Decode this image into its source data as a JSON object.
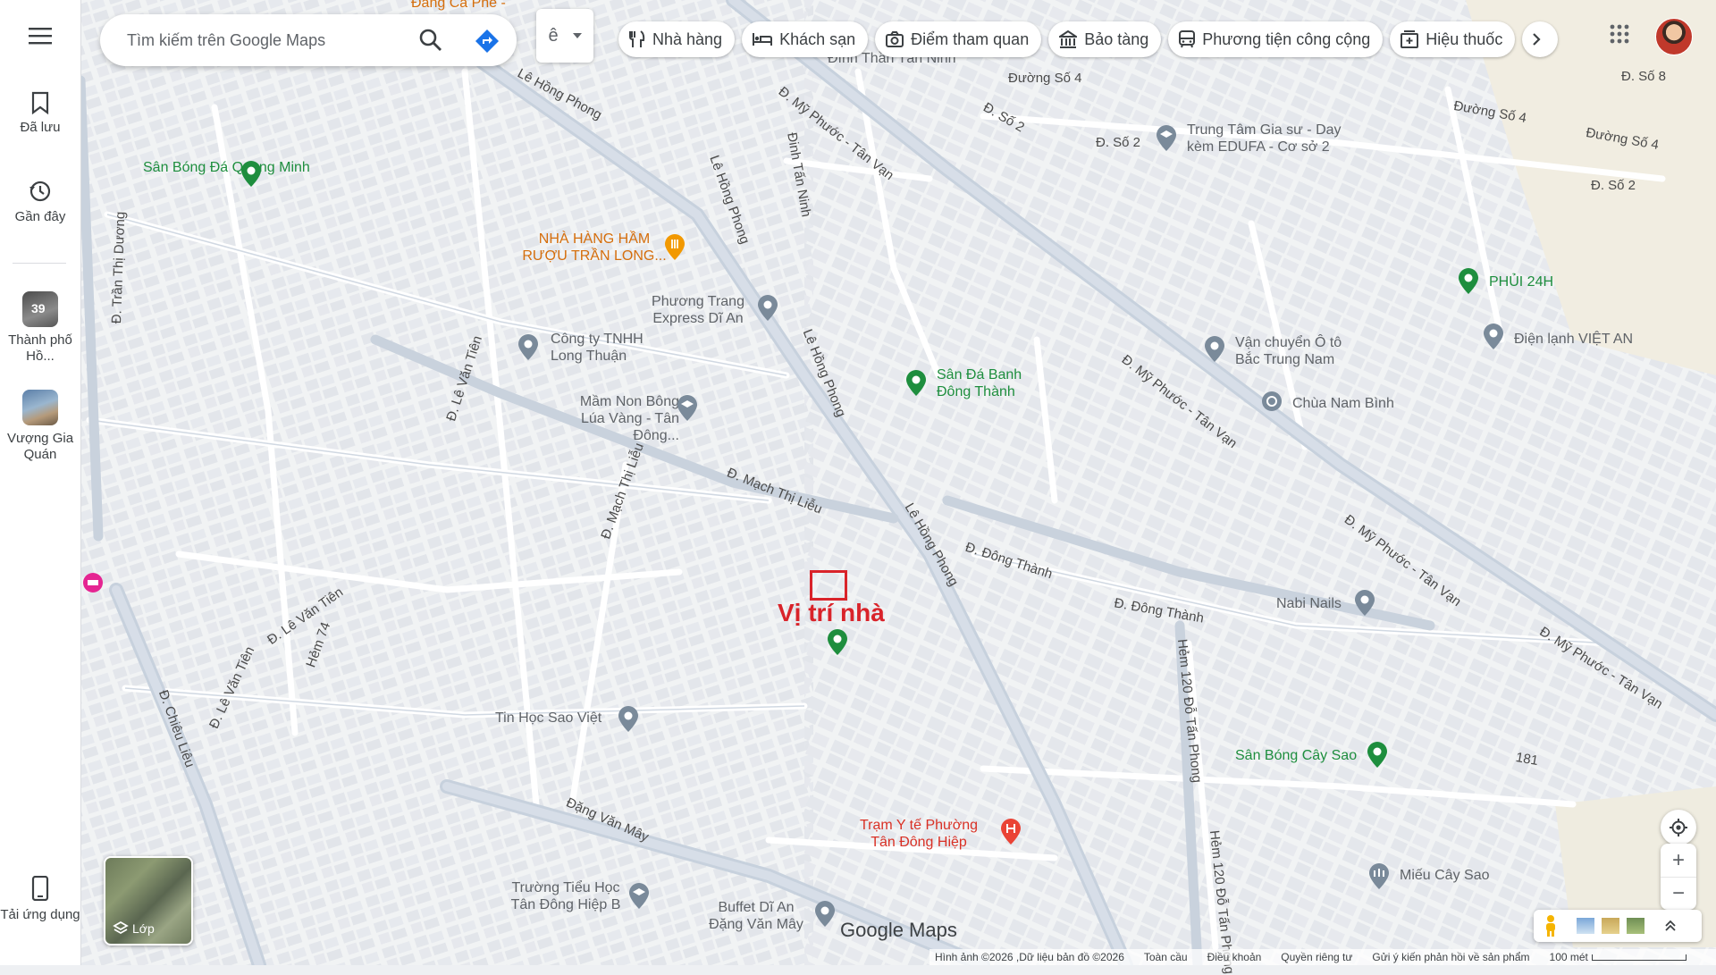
{
  "sidebar": {
    "menu_icon": "hamburger-menu-icon",
    "saved_label": "Đã lưu",
    "recent_label": "Gần đây",
    "recent_places": [
      {
        "label": "Thành phố Hồ...",
        "badge": "39"
      },
      {
        "label": "Vượng Gia Quán"
      }
    ],
    "get_app_label": "Tải ứng dụng"
  },
  "search": {
    "placeholder": "Tìm kiếm trên Google Maps",
    "search_icon": "search-icon",
    "directions_icon": "directions-icon"
  },
  "language": {
    "value": "ê"
  },
  "chips": [
    {
      "label": "Nhà hàng",
      "icon": "restaurant-icon"
    },
    {
      "label": "Khách sạn",
      "icon": "hotel-icon"
    },
    {
      "label": "Điểm tham quan",
      "icon": "camera-icon"
    },
    {
      "label": "Bảo tàng",
      "icon": "museum-icon"
    },
    {
      "label": "Phương tiện công cộng",
      "icon": "transit-icon"
    },
    {
      "label": "Hiệu thuốc",
      "icon": "pharmacy-icon"
    }
  ],
  "map": {
    "house_marker_label": "Vị trí nhà",
    "places": [
      {
        "name": "Sân Bóng Đá Quang Minh",
        "type": "green"
      },
      {
        "name": "NHÀ HÀNG HẦM RƯỢU TRẦN LONG...",
        "type": "orange"
      },
      {
        "name": "Phương Trang Express Dĩ An",
        "type": "poi"
      },
      {
        "name": "Công ty TNHH Long Thuận",
        "type": "poi"
      },
      {
        "name": "Mầm Non Bông Lúa Vàng - Tân Đông...",
        "type": "poi"
      },
      {
        "name": "Sân Đá Banh Đông Thành",
        "type": "green"
      },
      {
        "name": "Trung Tâm Gia sư - Day kèm EDUFA - Cơ sở 2",
        "type": "poi"
      },
      {
        "name": "PHỦI 24H",
        "type": "green"
      },
      {
        "name": "Vận chuyển Ô tô Bắc Trung Nam",
        "type": "poi"
      },
      {
        "name": "Điện lạnh VIỆT AN",
        "type": "poi"
      },
      {
        "name": "Chùa Nam Bình",
        "type": "poi"
      },
      {
        "name": "Nabi Nails",
        "type": "poi"
      },
      {
        "name": "Sân Bóng Cây Sao",
        "type": "green"
      },
      {
        "name": "Tin Học Sao Việt",
        "type": "poi"
      },
      {
        "name": "Trạm Y tế Phường Tân Đông Hiệp",
        "type": "red"
      },
      {
        "name": "Trường Tiểu Học Tân Đông Hiệp B",
        "type": "poi"
      },
      {
        "name": "Buffet Dĩ An Đặng Văn Mây",
        "type": "poi"
      },
      {
        "name": "Miếu Cây Sao",
        "type": "poi"
      },
      {
        "name": "Đang Cà Phê -",
        "type": "orange"
      },
      {
        "name": "Đình Thần Tân Ninh",
        "type": "poi"
      }
    ],
    "roads": [
      "Lê Hồng Phong",
      "Đ. Mỹ Phước - Tân Vạn",
      "Đ. Mạch Thị Liễu",
      "Đ. Đông Thành",
      "Đ. Lê Văn Tiên",
      "Đặng Văn Mây",
      "Đ. Chiêu Liêu",
      "Đường Số 4",
      "Đ. Số 2",
      "Đ. Số 8",
      "Đinh Tấn Ninh",
      "Hẻm 120 Đỗ Tấn Phong",
      "Hẻm 74",
      "Đ. Trần Thị Dương",
      "Đường Số 4",
      "181",
      "Đ. Số 2"
    ]
  },
  "controls": {
    "layers_label": "Lớp",
    "my_location_icon": "my-location-icon",
    "zoom_in": "+",
    "zoom_out": "−",
    "pegman_icon": "pegman-icon",
    "expand_icon": "chevron-up-icon"
  },
  "branding": "Google Maps",
  "footer": {
    "attribution": "Hình ảnh ©2026 ,Dữ liệu bản đồ ©2026",
    "global": "Toàn cầu",
    "terms": "Điều khoản",
    "privacy": "Quyền riêng tư",
    "feedback": "Gửi ý kiến phản hồi về sản phẩm",
    "scale": "100 mét"
  },
  "colors": {
    "map_background": "#f1f3f4",
    "block": "#e4e7ec",
    "major_road": "#c9d3de",
    "green_place": "#1e8e3e",
    "house_marker": "#d9232a"
  }
}
